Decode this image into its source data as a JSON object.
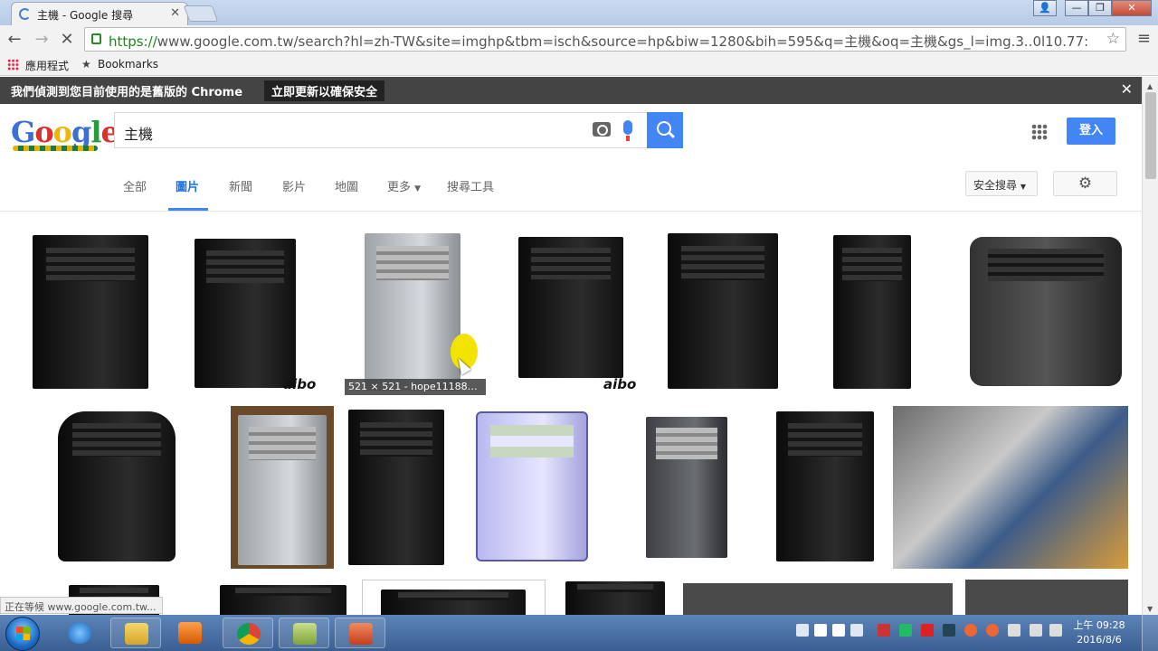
{
  "browser": {
    "tab_title": "主機 - Google 搜尋",
    "url_scheme": "https://",
    "url_rest": "www.google.com.tw/search?hl=zh-TW&site=imghp&tbm=isch&source=hp&biw=1280&bih=595&q=主機&oq=主機&gs_l=img.3..0l10.77:",
    "bookmarks": [
      "應用程式",
      "Bookmarks"
    ]
  },
  "infobar": {
    "message": "我們偵測到您目前使用的是舊版的 Chrome",
    "update_label": "立即更新以確保安全"
  },
  "header": {
    "logo": "Google",
    "search_query": "主機",
    "login_label": "登入"
  },
  "tabs": [
    "全部",
    "圖片",
    "新聞",
    "影片",
    "地圖",
    "更多",
    "搜尋工具"
  ],
  "active_tab": "圖片",
  "safe_search_label": "安全搜尋",
  "results": {
    "hover_caption": "521 × 521 - hope11188…",
    "watermark": "aibo"
  },
  "status_text": "正在等候 www.google.com.tw...",
  "taskbar": {
    "time": "上午 09:28",
    "date": "2016/8/6"
  },
  "colors": {
    "accent": "#4285f4",
    "infobar": "#444444",
    "taskbar": "#3a5f92"
  }
}
